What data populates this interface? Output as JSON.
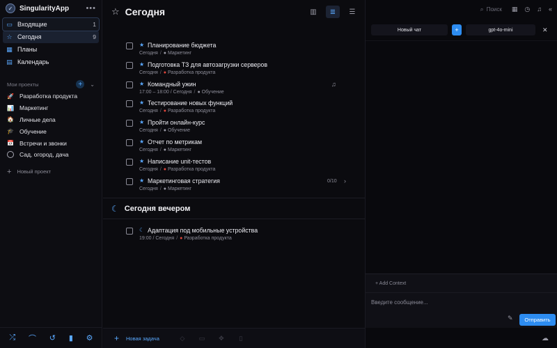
{
  "app": {
    "name": "SingularityApp",
    "more": "•••",
    "logo": "✓"
  },
  "nav": [
    {
      "label": "Входящие",
      "count": "1",
      "icon": "inbox-icon",
      "glyph": "▭"
    },
    {
      "label": "Сегодня",
      "count": "9",
      "icon": "star-icon",
      "glyph": "☆"
    },
    {
      "label": "Планы",
      "count": "",
      "icon": "calendar-grid-icon",
      "glyph": "▦"
    },
    {
      "label": "Календарь",
      "count": "",
      "icon": "calendar-icon",
      "glyph": "▤"
    }
  ],
  "projects": {
    "header": "Мои проекты",
    "items": [
      {
        "label": "Разработка продукта",
        "emoji": "🚀"
      },
      {
        "label": "Маркетинг",
        "emoji": "📊"
      },
      {
        "label": "Личные дела",
        "emoji": "🏠"
      },
      {
        "label": "Обучение",
        "emoji": "🎓"
      },
      {
        "label": "Встречи и звонки",
        "emoji": "📅"
      },
      {
        "label": "Сад, огород, дача",
        "emoji": ""
      }
    ],
    "new_label": "Новый проект"
  },
  "main": {
    "title": "Сегодня",
    "tasks": [
      {
        "title": "Планирование бюджета",
        "time": "",
        "date": "Сегодня",
        "project": "Маркетинг",
        "dot": "grey"
      },
      {
        "title": "Подготовка ТЗ для автозагрузки серверов",
        "time": "",
        "date": "Сегодня",
        "project": "Разработка продукта",
        "dot": "red"
      },
      {
        "title": "Командный ужин",
        "time": "17:00 – 18:00",
        "date": "Сегодня",
        "project": "Обучение",
        "dot": "grey",
        "bell": true
      },
      {
        "title": "Тестирование новых функций",
        "time": "",
        "date": "Сегодня",
        "project": "Разработка продукта",
        "dot": "red"
      },
      {
        "title": "Пройти онлайн-курс",
        "time": "",
        "date": "Сегодня",
        "project": "Обучение",
        "dot": "grey"
      },
      {
        "title": "Отчет по метрикам",
        "time": "",
        "date": "Сегодня",
        "project": "Маркетинг",
        "dot": "grey"
      },
      {
        "title": "Написание unit-тестов",
        "time": "",
        "date": "Сегодня",
        "project": "Разработка продукта",
        "dot": "red"
      },
      {
        "title": "Маркетинговая стратегия",
        "time": "",
        "date": "Сегодня",
        "project": "Маркетинг",
        "dot": "grey",
        "subtasks": "0/10"
      }
    ],
    "evening_title": "Сегодня вечером",
    "evening_tasks": [
      {
        "title": "Адаптация под мобильные устройства",
        "time": "19:00",
        "date": "Сегодня",
        "project": "Разработка продукта",
        "dot": "red"
      }
    ],
    "new_task_label": "Новая задача"
  },
  "chat": {
    "search_placeholder": "Поиск",
    "new_chat_label": "Новый чат",
    "model_label": "gpt-4o-mini",
    "add_context_label": "+ Add Context",
    "message_placeholder": "Введите сообщение...",
    "send_label": "Отправить"
  },
  "colors": {
    "accent": "#2d8cf0",
    "project_red": "#e0463c"
  }
}
